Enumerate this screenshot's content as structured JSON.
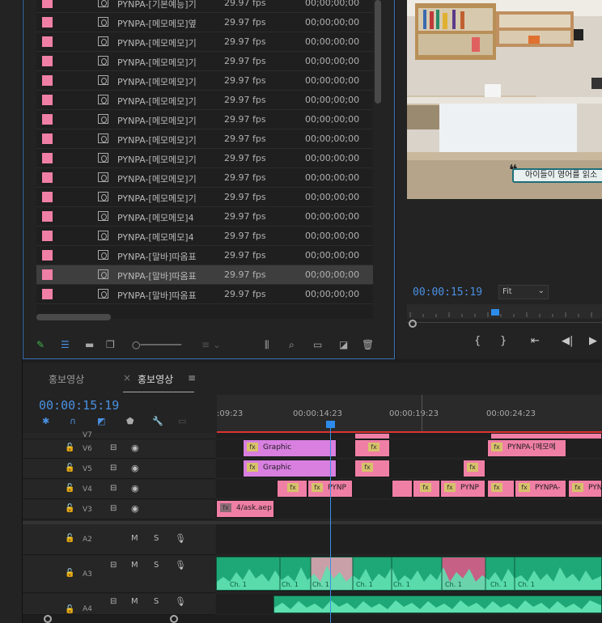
{
  "project": {
    "rows": [
      {
        "name": "PYNPA-[기본예능]기",
        "fps": "29.97 fps",
        "tc": "00;00;00;00"
      },
      {
        "name": "PYNPA-[메모메모]옆",
        "fps": "29.97 fps",
        "tc": "00;00;00;00"
      },
      {
        "name": "PYNPA-[메모메모]기",
        "fps": "29.97 fps",
        "tc": "00;00;00;00"
      },
      {
        "name": "PYNPA-[메모메모]기",
        "fps": "29.97 fps",
        "tc": "00;00;00;00"
      },
      {
        "name": "PYNPA-[메모메모]기",
        "fps": "29.97 fps",
        "tc": "00;00;00;00"
      },
      {
        "name": "PYNPA-[메모메모]기",
        "fps": "29.97 fps",
        "tc": "00;00;00;00"
      },
      {
        "name": "PYNPA-[메모메모]기",
        "fps": "29.97 fps",
        "tc": "00;00;00;00"
      },
      {
        "name": "PYNPA-[메모메모]기",
        "fps": "29.97 fps",
        "tc": "00;00;00;00"
      },
      {
        "name": "PYNPA-[메모메모]기",
        "fps": "29.97 fps",
        "tc": "00;00;00;00"
      },
      {
        "name": "PYNPA-[메모메모]기",
        "fps": "29.97 fps",
        "tc": "00;00;00;00"
      },
      {
        "name": "PYNPA-[메모메모]기",
        "fps": "29.97 fps",
        "tc": "00;00;00;00"
      },
      {
        "name": "PYNPA-[메모메모]4",
        "fps": "29.97 fps",
        "tc": "00;00;00;00"
      },
      {
        "name": "PYNPA-[메모메모]4",
        "fps": "29.97 fps",
        "tc": "00;00;00;00"
      },
      {
        "name": "PYNPA-[말바]따옴표",
        "fps": "29.97 fps",
        "tc": "00;00;00;00"
      },
      {
        "name": "PYNPA-[말바]따옴표",
        "fps": "29.97 fps",
        "tc": "00;00;00;00"
      },
      {
        "name": "PYNPA-[말바]따옴표",
        "fps": "29.97 fps",
        "tc": "00;00;00;00"
      }
    ],
    "selected_row": 14
  },
  "monitor": {
    "subtitle": "아이들이 영어를 읽소",
    "timecode": "00:00:15:19",
    "fit": "Fit",
    "controls": [
      "{",
      "}",
      "⇤",
      "◀|",
      "▶"
    ]
  },
  "timeline": {
    "tab_inactive": "홍보영상",
    "tab_active": "홍보영상",
    "timecode": "00:00:15:19",
    "ruler_labels": [
      ":09:23",
      "00:00:14:23",
      "00:00:19:23",
      "00:00:24:23"
    ],
    "video_tracks": [
      "V7",
      "V6",
      "V5",
      "V4",
      "V3"
    ],
    "audio_tracks": [
      "A2",
      "A3",
      "A4"
    ],
    "mute_label": "M",
    "solo_label": "S",
    "clips": {
      "graphic": "Graphic",
      "pynpa": "PYNPA-[메모메",
      "pynp": "PYNP",
      "pynpa_short": "PYNPA-",
      "pyn": "PYN",
      "ask": "4/ask.aep",
      "fx": "fx",
      "ch": "Ch. 1"
    }
  }
}
